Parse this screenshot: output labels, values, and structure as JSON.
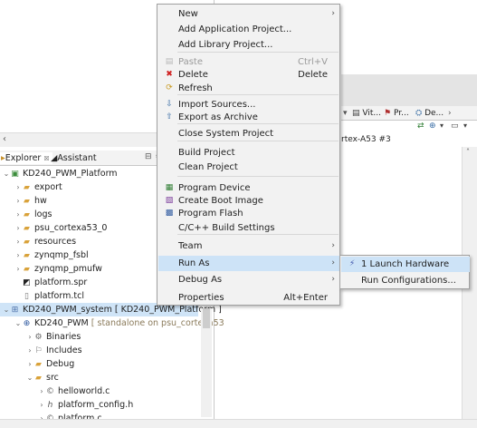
{
  "explorer": {
    "tabs": [
      {
        "label": "Explorer",
        "suffix": "☒"
      },
      {
        "label": "Assistant"
      }
    ],
    "tree": [
      {
        "label": "KD240_PWM_Platform",
        "twisty": "⌄",
        "icon": "platform-project-icon"
      },
      {
        "label": "export",
        "twisty": "›",
        "icon": "folder-icon"
      },
      {
        "label": "hw",
        "twisty": "›",
        "icon": "folder-icon"
      },
      {
        "label": "logs",
        "twisty": "›",
        "icon": "folder-icon"
      },
      {
        "label": "psu_cortexa53_0",
        "twisty": "›",
        "icon": "folder-icon"
      },
      {
        "label": "resources",
        "twisty": "›",
        "icon": "folder-icon"
      },
      {
        "label": "zynqmp_fsbl",
        "twisty": "›",
        "icon": "folder-icon"
      },
      {
        "label": "zynqmp_pmufw",
        "twisty": "›",
        "icon": "folder-icon"
      },
      {
        "label": "platform.spr",
        "twisty": "",
        "icon": "spr-file-icon"
      },
      {
        "label": "platform.tcl",
        "twisty": "",
        "icon": "file-icon"
      },
      {
        "label": "KD240_PWM_system [ KD240_PWM_Platform ]",
        "twisty": "⌄",
        "icon": "system-project-icon"
      },
      {
        "label": "KD240_PWM",
        "detail": " [ standalone on psu_cortexa53",
        "twisty": "⌄",
        "icon": "app-project-icon"
      },
      {
        "label": "Binaries",
        "twisty": "›",
        "icon": "binaries-icon"
      },
      {
        "label": "Includes",
        "twisty": "›",
        "icon": "includes-icon"
      },
      {
        "label": "Debug",
        "twisty": "›",
        "icon": "folder-icon"
      },
      {
        "label": "src",
        "twisty": "⌄",
        "icon": "folder-icon"
      },
      {
        "label": "helloworld.c",
        "twisty": "›",
        "icon": "c-file-icon"
      },
      {
        "label": "platform_config.h",
        "twisty": "›",
        "icon": "h-file-icon"
      },
      {
        "label": "platform.c",
        "twisty": "›",
        "icon": "c-file-icon"
      }
    ]
  },
  "right_panel": {
    "tabs": [
      "Vit...",
      "Pr...",
      "De..."
    ],
    "label": "rtex-A53 #3"
  },
  "context_menu": {
    "items": [
      {
        "label": "New",
        "shortcut": "",
        "submenu": true,
        "disabled": false,
        "icon": ""
      },
      {
        "label": "Add Application Project...",
        "shortcut": "",
        "submenu": false,
        "disabled": false,
        "icon": ""
      },
      {
        "label": "Add Library Project...",
        "shortcut": "",
        "submenu": false,
        "disabled": false,
        "icon": ""
      },
      {
        "label": "Paste",
        "shortcut": "Ctrl+V",
        "submenu": false,
        "disabled": true,
        "icon": "paste-icon"
      },
      {
        "label": "Delete",
        "shortcut": "Delete",
        "submenu": false,
        "disabled": false,
        "icon": "delete-icon"
      },
      {
        "label": "Refresh",
        "shortcut": "",
        "submenu": false,
        "disabled": false,
        "icon": "refresh-icon"
      },
      {
        "label": "Import Sources...",
        "shortcut": "",
        "submenu": false,
        "disabled": false,
        "icon": "import-icon"
      },
      {
        "label": "Export as Archive",
        "shortcut": "",
        "submenu": false,
        "disabled": false,
        "icon": "export-icon"
      },
      {
        "label": "Close System Project",
        "shortcut": "",
        "submenu": false,
        "disabled": false,
        "icon": ""
      },
      {
        "label": "Build Project",
        "shortcut": "",
        "submenu": false,
        "disabled": false,
        "icon": ""
      },
      {
        "label": "Clean Project",
        "shortcut": "",
        "submenu": false,
        "disabled": false,
        "icon": ""
      },
      {
        "label": "Program Device",
        "shortcut": "",
        "submenu": false,
        "disabled": false,
        "icon": "program-device-icon"
      },
      {
        "label": "Create Boot Image",
        "shortcut": "",
        "submenu": false,
        "disabled": false,
        "icon": "boot-image-icon"
      },
      {
        "label": "Program Flash",
        "shortcut": "",
        "submenu": false,
        "disabled": false,
        "icon": "program-flash-icon"
      },
      {
        "label": "C/C++ Build Settings",
        "shortcut": "",
        "submenu": false,
        "disabled": false,
        "icon": ""
      },
      {
        "label": "Team",
        "shortcut": "",
        "submenu": true,
        "disabled": false,
        "icon": ""
      },
      {
        "label": "Run As",
        "shortcut": "",
        "submenu": true,
        "disabled": false,
        "icon": "",
        "active": true
      },
      {
        "label": "Debug As",
        "shortcut": "",
        "submenu": true,
        "disabled": false,
        "icon": ""
      },
      {
        "label": "Properties",
        "shortcut": "Alt+Enter",
        "submenu": false,
        "disabled": false,
        "icon": ""
      }
    ]
  },
  "submenu": {
    "items": [
      {
        "label": "1 Launch Hardware",
        "icon": "launch-hardware-icon"
      },
      {
        "label": "Run Configurations...",
        "icon": ""
      }
    ]
  }
}
